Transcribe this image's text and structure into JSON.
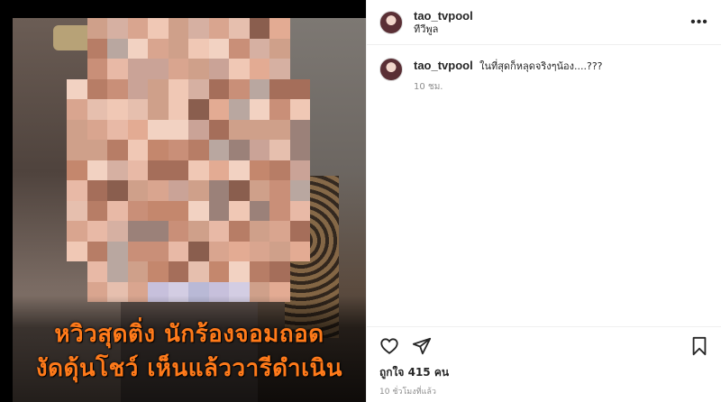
{
  "post": {
    "username": "tao_tvpool",
    "location": "ทีวีพูล"
  },
  "media": {
    "caption_line1": "หวิวสุดติ่ง นักร้องจอมถอด",
    "caption_line2": "งัดดุ้นโชว์ เห็นแล้ววารีดำเนิน",
    "caption_color": "#ff7a1a"
  },
  "comment": {
    "username": "tao_tvpool",
    "text": "ในที่สุดก็หลุดจริงๆน้อง....???",
    "time": "10 ชม."
  },
  "actions": {
    "like_icon": "heart-icon",
    "share_icon": "paper-plane-icon",
    "save_icon": "bookmark-icon"
  },
  "likes_text": "ถูกใจ 415 คน",
  "post_time": "10 ชั่วโมงที่แล้ว",
  "more_icon": "more-options-icon"
}
